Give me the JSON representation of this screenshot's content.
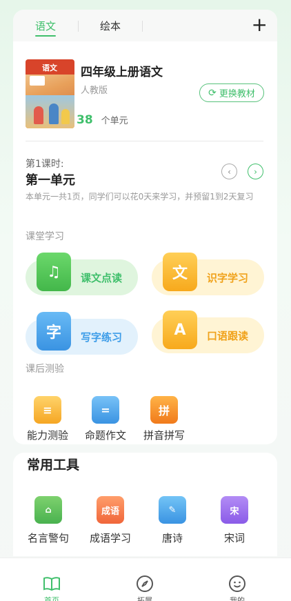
{
  "tabs": [
    {
      "label": "语文",
      "active": true
    },
    {
      "label": "绘本",
      "active": false
    }
  ],
  "add_icon": "plus-icon",
  "book": {
    "cover_title": "语文",
    "title": "四年级上册语文",
    "publisher": "人教版",
    "unit_count": "38",
    "unit_suffix": "个单元",
    "change_button": "更换教材"
  },
  "lesson": {
    "label": "第1课时:",
    "title": "第一单元",
    "description": "本单元一共1页，同学们可以花0天来学习，并预留1到2天复习"
  },
  "classroom": {
    "label": "课堂学习",
    "items": [
      {
        "label": "课文点读",
        "icon": "music-book-icon",
        "glyph": "♫"
      },
      {
        "label": "识字学习",
        "icon": "character-learn-icon",
        "glyph": "文"
      },
      {
        "label": "写字练习",
        "icon": "writing-icon",
        "glyph": "字"
      },
      {
        "label": "口语跟读",
        "icon": "speech-icon",
        "glyph": "A"
      }
    ]
  },
  "after_class": {
    "label": "课后测验",
    "items": [
      {
        "label": "能力测验",
        "icon": "ability-test-icon",
        "glyph": "≡"
      },
      {
        "label": "命题作文",
        "icon": "essay-icon",
        "glyph": "="
      },
      {
        "label": "拼音拼写",
        "icon": "pinyin-icon",
        "glyph": "拼"
      }
    ]
  },
  "tools": {
    "title": "常用工具",
    "items": [
      {
        "label": "名言警句",
        "icon": "quote-icon",
        "glyph": ""
      },
      {
        "label": "成语学习",
        "icon": "idiom-icon",
        "glyph": "成语"
      },
      {
        "label": "唐诗",
        "icon": "tang-poem-icon",
        "glyph": ""
      },
      {
        "label": "宋词",
        "icon": "song-ci-icon",
        "glyph": "宋"
      }
    ]
  },
  "bottom_nav": [
    {
      "label": "首页",
      "icon": "book-open-icon",
      "active": true
    },
    {
      "label": "拓展",
      "icon": "compass-icon",
      "active": false
    },
    {
      "label": "我的",
      "icon": "smiley-icon",
      "active": false
    }
  ],
  "colors": {
    "accent": "#3fbf6b",
    "yellow": "#f0a21b",
    "blue": "#3c9ce8"
  }
}
